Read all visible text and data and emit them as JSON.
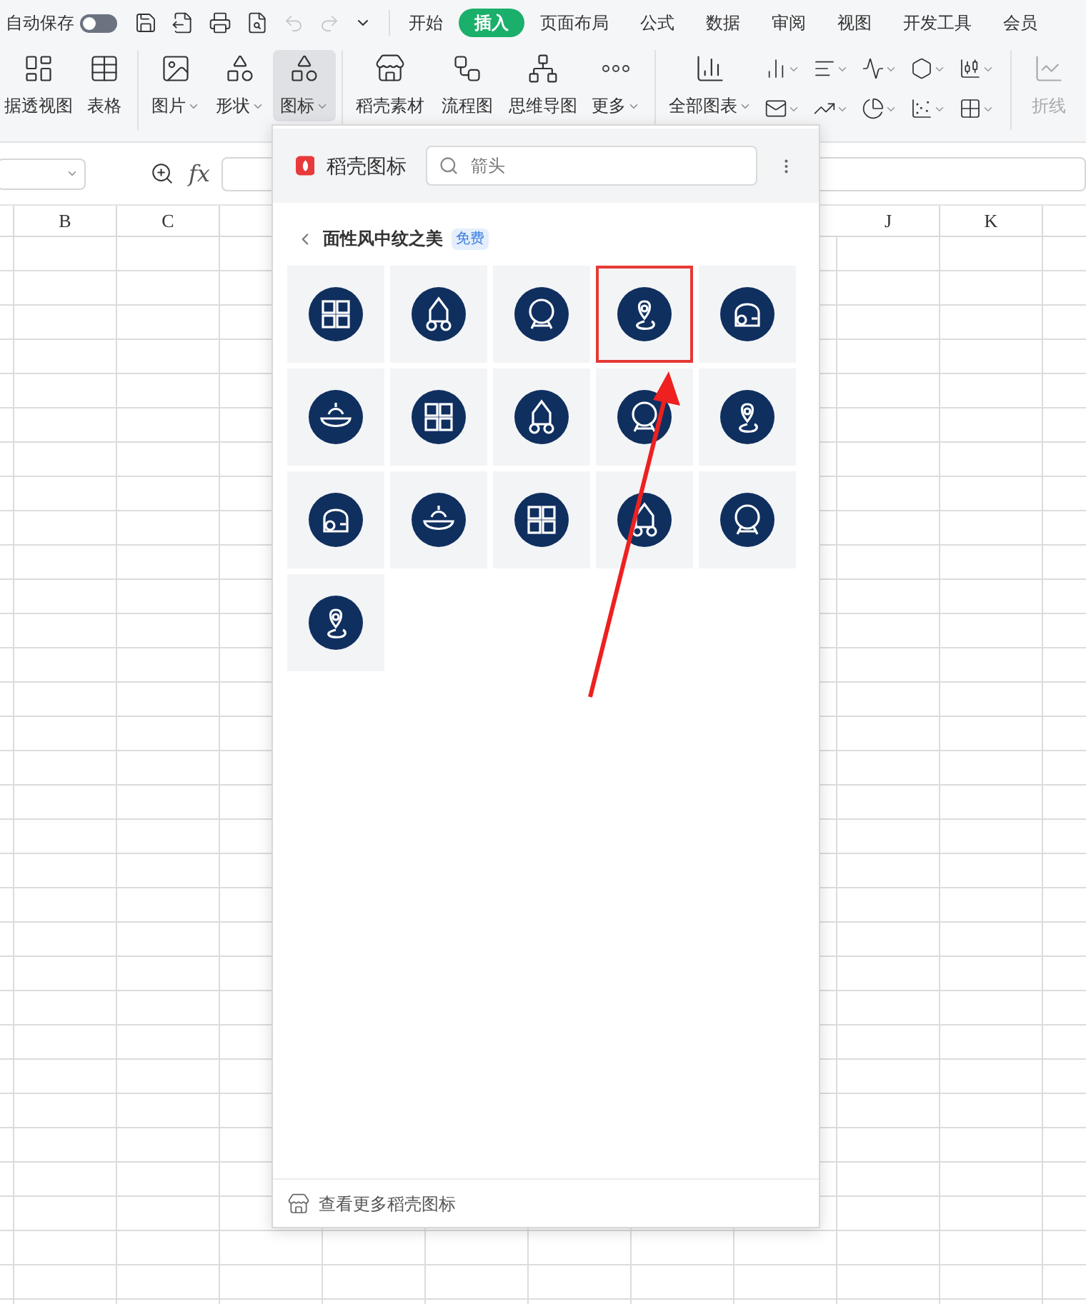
{
  "quick_access": {
    "autosave_label": "自动保存",
    "autosave_on": false
  },
  "tabs": [
    {
      "label": "开始",
      "selected": false
    },
    {
      "label": "插入",
      "selected": true
    },
    {
      "label": "页面布局",
      "selected": false
    },
    {
      "label": "公式",
      "selected": false
    },
    {
      "label": "数据",
      "selected": false
    },
    {
      "label": "审阅",
      "selected": false
    },
    {
      "label": "视图",
      "selected": false
    },
    {
      "label": "开发工具",
      "selected": false
    },
    {
      "label": "会员",
      "selected": false
    }
  ],
  "ribbon": [
    {
      "label": "据透视图",
      "kind": "pivot",
      "dropdown": false,
      "selected": false
    },
    {
      "label": "表格",
      "kind": "table",
      "dropdown": false,
      "selected": false
    },
    {
      "label": "图片",
      "kind": "image",
      "dropdown": true,
      "selected": false
    },
    {
      "label": "形状",
      "kind": "shape",
      "dropdown": true,
      "selected": false
    },
    {
      "label": "图标",
      "kind": "icons",
      "dropdown": true,
      "selected": true
    },
    {
      "label": "稻壳素材",
      "kind": "store",
      "dropdown": false,
      "selected": false
    },
    {
      "label": "流程图",
      "kind": "flow",
      "dropdown": false,
      "selected": false
    },
    {
      "label": "思维导图",
      "kind": "mind",
      "dropdown": false,
      "selected": false
    },
    {
      "label": "更多",
      "kind": "more",
      "dropdown": true,
      "selected": false
    },
    {
      "label": "全部图表",
      "kind": "chart",
      "dropdown": true,
      "selected": false
    }
  ],
  "line_chart_button": {
    "label": "折线",
    "disabled": true
  },
  "formula_bar": {
    "function_label": "fx"
  },
  "column_headers": [
    "B",
    "C",
    "J",
    "K"
  ],
  "icon_panel": {
    "title": "稻壳图标",
    "search": {
      "value": "箭头"
    },
    "category": "面性风中纹之美",
    "badge": "免费",
    "tiles": [
      {
        "highlighted": false
      },
      {
        "highlighted": false
      },
      {
        "highlighted": false
      },
      {
        "highlighted": true
      },
      {
        "highlighted": false
      },
      {
        "highlighted": false
      },
      {
        "highlighted": false
      },
      {
        "highlighted": false
      },
      {
        "highlighted": false
      },
      {
        "highlighted": false
      },
      {
        "highlighted": false
      },
      {
        "highlighted": false
      },
      {
        "highlighted": false
      },
      {
        "highlighted": false
      },
      {
        "highlighted": false
      },
      {
        "highlighted": false
      }
    ],
    "footer_link": "查看更多稻壳图标"
  }
}
